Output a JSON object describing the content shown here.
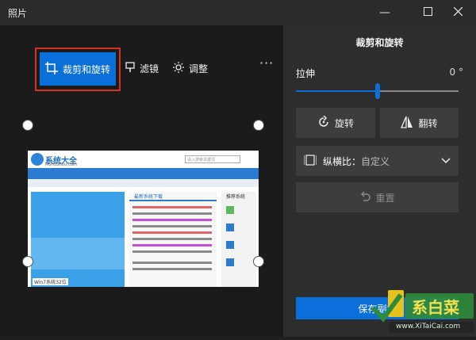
{
  "app": {
    "title": "照片"
  },
  "toolbar": {
    "crop_rotate_label": "裁剪和旋转",
    "filters_label": "滤镜",
    "adjust_label": "调整",
    "more_label": "···"
  },
  "panel": {
    "title": "裁剪和旋转",
    "straighten_label": "拉伸",
    "straighten_value": "0 °",
    "straighten_level": 0.5,
    "rotate_label": "旋转",
    "flip_label": "翻转",
    "aspect_label": "纵横比：",
    "aspect_value": "自定义",
    "reset_label": "重置",
    "save_copy_label": "保存副本"
  },
  "preview": {
    "site_name": "系统大全",
    "site_url": "MoHuShou.Com",
    "search_placeholder": "请入搜索关键词",
    "section_title": "最新系统下载",
    "side_title": "推荐系统",
    "bottom_tab": "Win7系统32位"
  },
  "watermark": {
    "brand": "系白菜",
    "url": "www.XiTaiCai.com"
  },
  "colors": {
    "accent": "#0a6fd8",
    "highlight": "#d93025"
  }
}
